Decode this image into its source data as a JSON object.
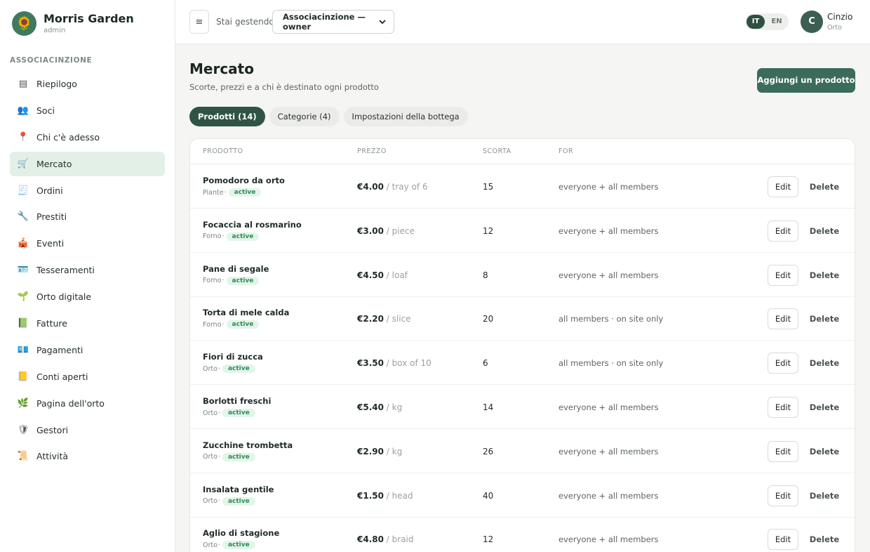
{
  "sidebar": {
    "brand_name": "Morris Garden",
    "brand_role": "admin",
    "section_label": "ASSOCIACINZIONE",
    "items": [
      {
        "label": "Riepilogo",
        "icon": "▤"
      },
      {
        "label": "Soci",
        "icon": "👥"
      },
      {
        "label": "Chi c'è adesso",
        "icon": "📍"
      },
      {
        "label": "Mercato",
        "icon": "🛒"
      },
      {
        "label": "Ordini",
        "icon": "🧾"
      },
      {
        "label": "Prestiti",
        "icon": "🔧"
      },
      {
        "label": "Eventi",
        "icon": "🎪"
      },
      {
        "label": "Tesseramenti",
        "icon": "🪪"
      },
      {
        "label": "Orto digitale",
        "icon": "🌱"
      },
      {
        "label": "Fatture",
        "icon": "📗"
      },
      {
        "label": "Pagamenti",
        "icon": "💶"
      },
      {
        "label": "Conti aperti",
        "icon": "📒"
      },
      {
        "label": "Pagina dell'orto",
        "icon": "🌿"
      },
      {
        "label": "Gestori",
        "icon": "🛡"
      },
      {
        "label": "Attività",
        "icon": "📜"
      }
    ],
    "active_index": 3
  },
  "topbar": {
    "menu_icon": "≡",
    "managing_label": "Stai gestendo",
    "select_value": "Associacinzione — owner",
    "lang_it": "IT",
    "lang_en": "EN",
    "avatar_initial": "C",
    "user_name": "Cinzio",
    "user_sub": "Orto"
  },
  "main": {
    "title": "Mercato",
    "subtitle": "Scorte, prezzi e a chi è destinato ogni prodotto",
    "add_button": "Aggiungi un prodotto",
    "tabs": [
      "Prodotti (14)",
      "Categorie (4)",
      "Impostazioni della bottega"
    ],
    "columns": [
      "PRODOTTO",
      "PREZZO",
      "SCORTA",
      "FOR"
    ],
    "edit_label": "Edit",
    "delete_label": "Delete",
    "rows": [
      {
        "name": "Pomodoro da orto",
        "category": "Piante",
        "status": "active",
        "price": "€4.00",
        "unit": "/ tray of 6",
        "stock": "15",
        "for": "everyone + all members"
      },
      {
        "name": "Focaccia al rosmarino",
        "category": "Forno",
        "status": "active",
        "price": "€3.00",
        "unit": "/ piece",
        "stock": "12",
        "for": "everyone + all members"
      },
      {
        "name": "Pane di segale",
        "category": "Forno",
        "status": "active",
        "price": "€4.50",
        "unit": "/ loaf",
        "stock": "8",
        "for": "everyone + all members"
      },
      {
        "name": "Torta di mele calda",
        "category": "Forno",
        "status": "active",
        "price": "€2.20",
        "unit": "/ slice",
        "stock": "20",
        "for": "all members · on site only"
      },
      {
        "name": "Fiori di zucca",
        "category": "Orto",
        "status": "active",
        "price": "€3.50",
        "unit": "/ box of 10",
        "stock": "6",
        "for": "all members · on site only"
      },
      {
        "name": "Borlotti freschi",
        "category": "Orto",
        "status": "active",
        "price": "€5.40",
        "unit": "/ kg",
        "stock": "14",
        "for": "everyone + all members"
      },
      {
        "name": "Zucchine trombetta",
        "category": "Orto",
        "status": "active",
        "price": "€2.90",
        "unit": "/ kg",
        "stock": "26",
        "for": "everyone + all members"
      },
      {
        "name": "Insalata gentile",
        "category": "Orto",
        "status": "active",
        "price": "€1.50",
        "unit": "/ head",
        "stock": "40",
        "for": "everyone + all members"
      },
      {
        "name": "Aglio di stagione",
        "category": "Orto",
        "status": "active",
        "price": "€4.80",
        "unit": "/ braid",
        "stock": "12",
        "for": "everyone + all members"
      }
    ]
  }
}
